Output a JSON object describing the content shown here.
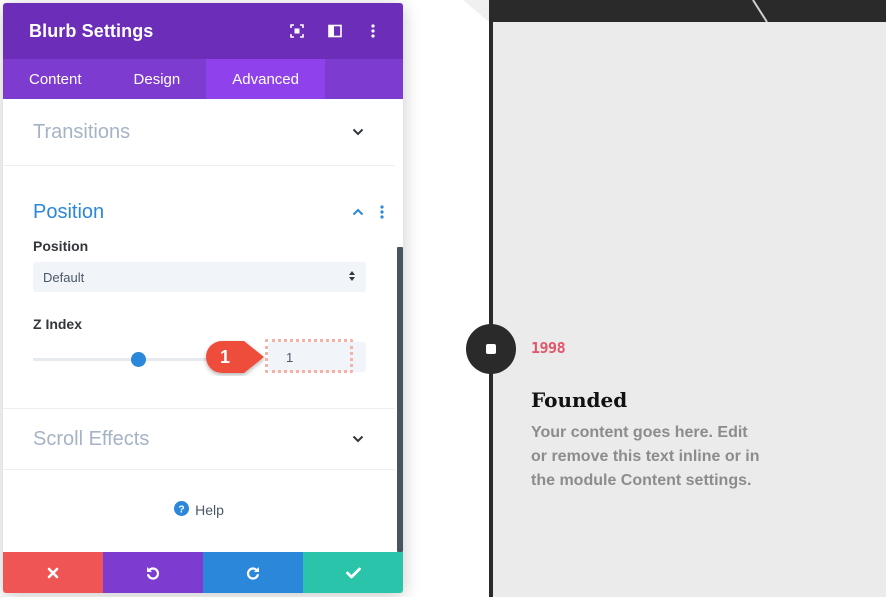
{
  "panel": {
    "title": "Blurb Settings",
    "header_icons": [
      "fullscreen-icon",
      "split-view-icon",
      "more-options-icon"
    ]
  },
  "tabs": [
    {
      "label": "Content",
      "active": false
    },
    {
      "label": "Design",
      "active": false
    },
    {
      "label": "Advanced",
      "active": true
    }
  ],
  "sections": {
    "transitions": {
      "title": "Transitions"
    },
    "position": {
      "title": "Position",
      "position_label": "Position",
      "position_value": "Default",
      "zindex_label": "Z Index",
      "zindex_value": "1",
      "zindex_slider_fraction": 0.5
    },
    "scroll_effects": {
      "title": "Scroll Effects"
    }
  },
  "help": {
    "label": "Help"
  },
  "annotation": {
    "badge_number": "1"
  },
  "footer": {
    "buttons": [
      "close-icon",
      "undo-icon",
      "redo-icon",
      "check-icon"
    ]
  },
  "preview": {
    "year": "1998",
    "title": "Founded",
    "body": "Your content goes here. Edit or remove this text inline or in the module Content settings."
  },
  "colors": {
    "header": "#6c2eb9",
    "tabs": "#7e3bd0",
    "active_tab": "#8f42ec",
    "accent_blue": "#2b87da",
    "cancel": "#ef5555",
    "save": "#29c4a9",
    "year": "#e0566a",
    "badge": "#ee4d3b"
  }
}
